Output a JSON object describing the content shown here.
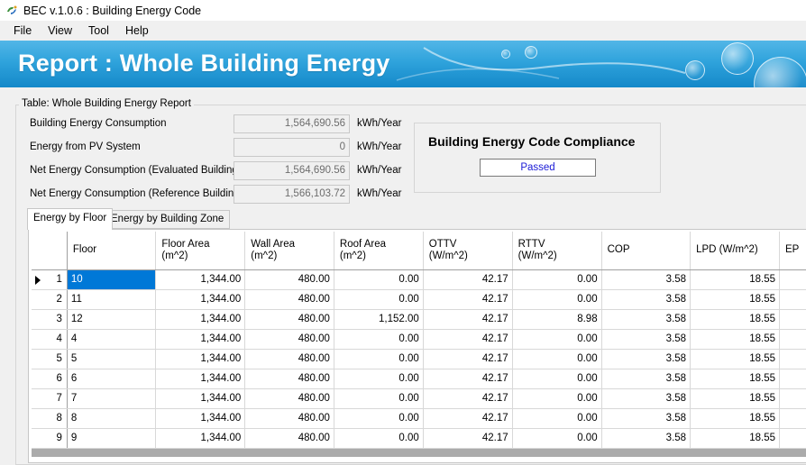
{
  "window": {
    "title": "BEC v.1.0.6 : Building Energy Code",
    "icon": "bec-app-icon"
  },
  "menu": [
    "File",
    "View",
    "Tool",
    "Help"
  ],
  "banner": {
    "title": "Report : Whole Building Energy"
  },
  "group": {
    "title": "Table: Whole Building Energy Report"
  },
  "stats": [
    {
      "label": "Building Energy Consumption",
      "value": "1,564,690.56",
      "unit": "kWh/Year"
    },
    {
      "label": "Energy from PV System",
      "value": "0",
      "unit": "kWh/Year"
    },
    {
      "label": "Net Energy Consumption (Evaluated Building)",
      "value": "1,564,690.56",
      "unit": "kWh/Year"
    },
    {
      "label": "Net Energy Consumption (Reference Building)",
      "value": "1,566,103.72",
      "unit": "kWh/Year"
    }
  ],
  "compliance": {
    "title": "Building Energy Code Compliance",
    "status": "Passed",
    "status_color": "#1a1ad6"
  },
  "tabs": [
    {
      "label": "Energy by Floor",
      "active": true
    },
    {
      "label": "Energy by Building Zone",
      "active": false
    }
  ],
  "grid": {
    "columns": [
      {
        "line1": "Floor",
        "line2": ""
      },
      {
        "line1": "Floor Area",
        "line2": "(m^2)"
      },
      {
        "line1": "Wall Area",
        "line2": "(m^2)"
      },
      {
        "line1": "Roof Area",
        "line2": "(m^2)"
      },
      {
        "line1": "OTTV",
        "line2": "(W/m^2)"
      },
      {
        "line1": "RTTV",
        "line2": "(W/m^2)"
      },
      {
        "line1": "COP",
        "line2": ""
      },
      {
        "line1": "LPD (W/m^2)",
        "line2": ""
      },
      {
        "line1": "EP",
        "line2": ""
      }
    ],
    "rows": [
      {
        "index": "1",
        "cells": [
          "10",
          "1,344.00",
          "480.00",
          "0.00",
          "42.17",
          "0.00",
          "3.58",
          "18.55"
        ]
      },
      {
        "index": "2",
        "cells": [
          "11",
          "1,344.00",
          "480.00",
          "0.00",
          "42.17",
          "0.00",
          "3.58",
          "18.55"
        ]
      },
      {
        "index": "3",
        "cells": [
          "12",
          "1,344.00",
          "480.00",
          "1,152.00",
          "42.17",
          "8.98",
          "3.58",
          "18.55"
        ]
      },
      {
        "index": "4",
        "cells": [
          "4",
          "1,344.00",
          "480.00",
          "0.00",
          "42.17",
          "0.00",
          "3.58",
          "18.55"
        ]
      },
      {
        "index": "5",
        "cells": [
          "5",
          "1,344.00",
          "480.00",
          "0.00",
          "42.17",
          "0.00",
          "3.58",
          "18.55"
        ]
      },
      {
        "index": "6",
        "cells": [
          "6",
          "1,344.00",
          "480.00",
          "0.00",
          "42.17",
          "0.00",
          "3.58",
          "18.55"
        ]
      },
      {
        "index": "7",
        "cells": [
          "7",
          "1,344.00",
          "480.00",
          "0.00",
          "42.17",
          "0.00",
          "3.58",
          "18.55"
        ]
      },
      {
        "index": "8",
        "cells": [
          "8",
          "1,344.00",
          "480.00",
          "0.00",
          "42.17",
          "0.00",
          "3.58",
          "18.55"
        ]
      },
      {
        "index": "9",
        "cells": [
          "9",
          "1,344.00",
          "480.00",
          "0.00",
          "42.17",
          "0.00",
          "3.58",
          "18.55"
        ]
      }
    ],
    "selected_row_index": 0,
    "selection_color": "#0078d7"
  },
  "colors": {
    "banner_top": "#52b6e7",
    "banner_bottom": "#1488c9"
  }
}
